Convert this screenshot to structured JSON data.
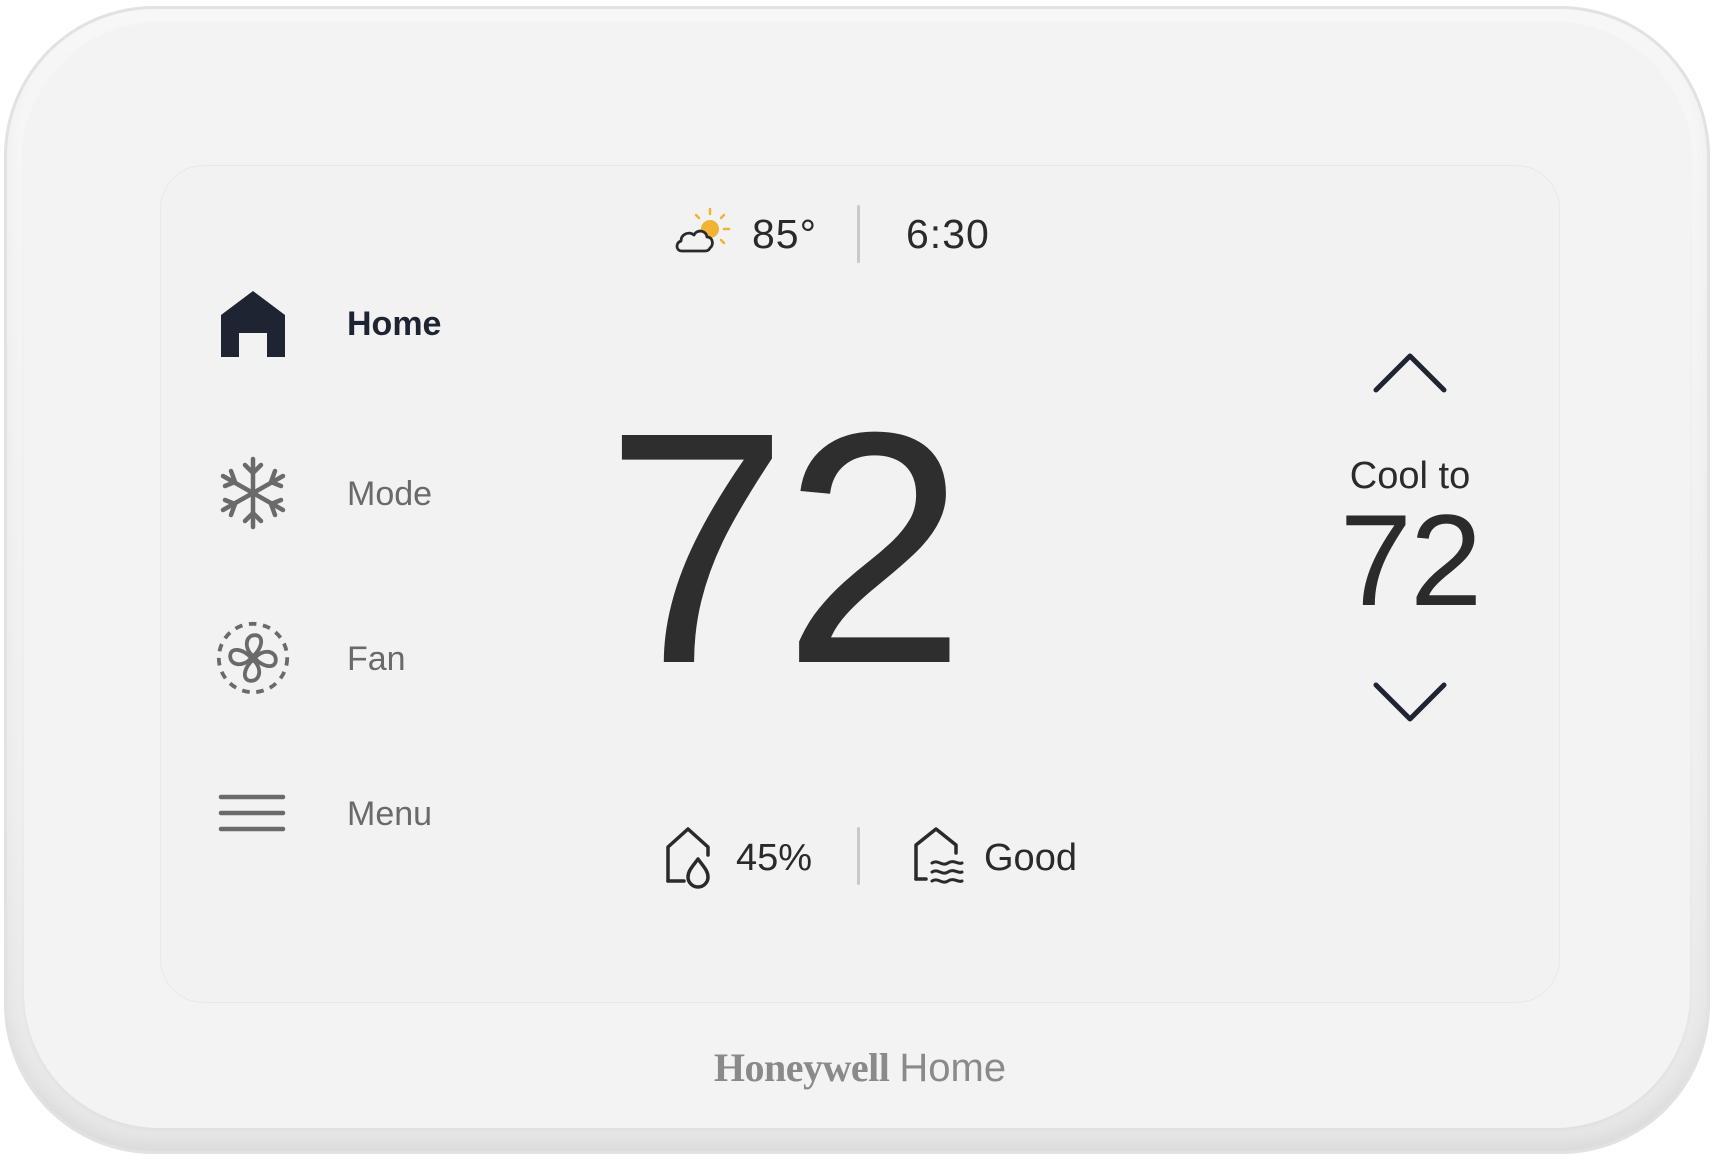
{
  "weather": {
    "icon": "partly-sunny-icon",
    "outdoor_temp": "85°"
  },
  "clock": "6:30",
  "nav": {
    "items": [
      {
        "label": "Home",
        "icon": "home-icon",
        "active": true
      },
      {
        "label": "Mode",
        "icon": "snowflake-icon",
        "active": false
      },
      {
        "label": "Fan",
        "icon": "fan-icon",
        "active": false
      },
      {
        "label": "Menu",
        "icon": "hamburger-menu-icon",
        "active": false
      }
    ]
  },
  "current_temp": "72",
  "setpoint": {
    "label": "Cool to",
    "value": "72"
  },
  "status": {
    "humidity": "45%",
    "humidity_icon": "home-humidity-icon",
    "air_quality": "Good",
    "air_quality_icon": "home-air-quality-icon"
  },
  "brand": {
    "name_bold": "Honeywell",
    "name_light": "Home"
  },
  "colors": {
    "accent_sun": "#f2b233",
    "active_nav": "#1f2433",
    "inactive_nav": "#6a6a6a",
    "text_primary": "#2e2e2e",
    "screen_bg": "#f2f2f2"
  }
}
